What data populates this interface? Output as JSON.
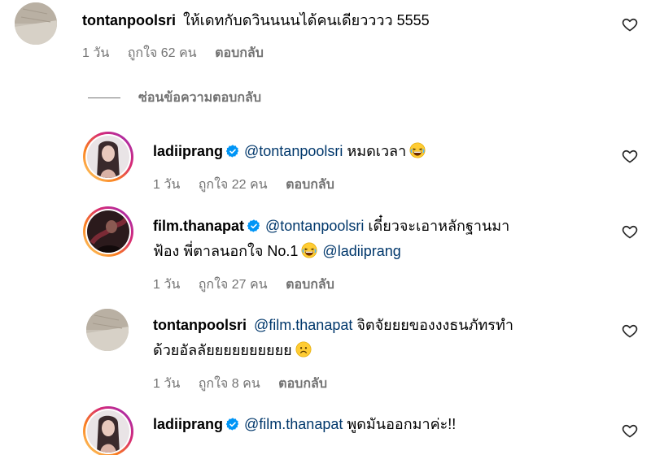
{
  "comments": [
    {
      "username": "tontanpoolsri",
      "text": "ให้เดทกับดวินนนนได้คนเดียวววว 5555",
      "time": "1 วัน",
      "likes": "ถูกใจ 62 คน",
      "reply": "ตอบกลับ"
    },
    {
      "username": "ladiiprang",
      "mention": "@tontanpoolsri",
      "text": "หมดเวลา",
      "emoji": "grinning-sweat-laugh-emoji",
      "time": "1 วัน",
      "likes": "ถูกใจ 22 คน",
      "reply": "ตอบกลับ"
    },
    {
      "username": "film.thanapat",
      "mention": "@tontanpoolsri",
      "text_line1": "เดี๋ยวจะเอาหลักฐานมา",
      "text_line2": "ฟ้อง พี่ตาลนอกใจ No.1",
      "mention2": "@ladiiprang",
      "time": "1 วัน",
      "likes": "ถูกใจ 27 คน",
      "reply": "ตอบกลับ"
    },
    {
      "username": "tontanpoolsri",
      "mention": "@film.thanapat",
      "text_line1": "จิตจัยยยของงงธนภัทรทำ",
      "text_line2": "ด้วยอัลลัยยยยยยยยยย",
      "emoji": "sad-face-emoji",
      "time": "1 วัน",
      "likes": "ถูกใจ 8 คน",
      "reply": "ตอบกลับ"
    },
    {
      "username": "ladiiprang",
      "mention": "@film.thanapat",
      "text": "พูดมันออกมาค่ะ!!"
    }
  ],
  "hide_replies": "ซ่อนข้อความตอบกลับ",
  "colors": {
    "mention": "#00376b",
    "meta": "#737373",
    "verified": "#0095f6"
  }
}
